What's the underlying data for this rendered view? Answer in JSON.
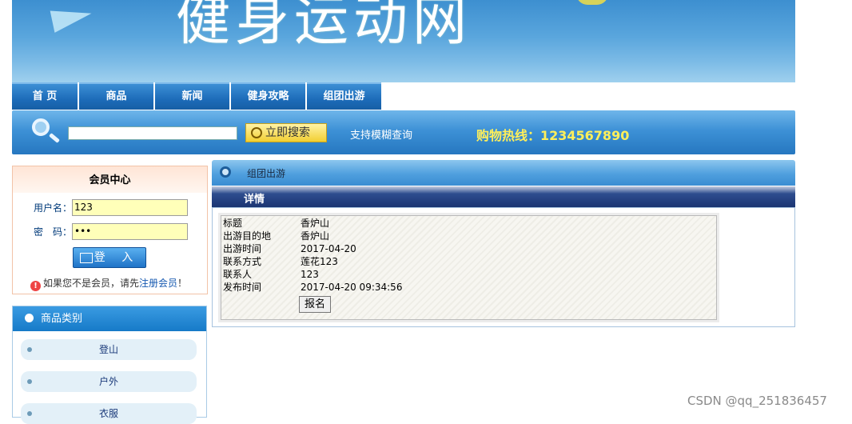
{
  "banner": {
    "title": "健身运动网"
  },
  "nav": {
    "tabs": [
      "首 页",
      "商品",
      "新闻",
      "健身攻略",
      "组团出游"
    ]
  },
  "search": {
    "value": "",
    "button_label": "立即搜索",
    "hint": "支持模糊查询",
    "hotline": "购物热线：1234567890"
  },
  "member": {
    "title": "会员中心",
    "username_label": "用户名：",
    "username_value": "123",
    "password_label": "密　码：",
    "password_value": "•••",
    "login_label": "登 入",
    "note_prefix": "如果您不是会员，请先",
    "note_link": "注册会员",
    "note_suffix": "！"
  },
  "category": {
    "title": "商品类别",
    "items": [
      "登山",
      "户外",
      "衣服"
    ]
  },
  "content": {
    "breadcrumb": "组团出游",
    "section_title": "详情",
    "rows": [
      {
        "key": "标题",
        "value": "香炉山"
      },
      {
        "key": "出游目的地",
        "value": "香炉山"
      },
      {
        "key": "出游时间",
        "value": "2017-04-20"
      },
      {
        "key": "联系方式",
        "value": "莲花123"
      },
      {
        "key": "联系人",
        "value": "123"
      },
      {
        "key": "发布时间",
        "value": "2017-04-20 09:34:56"
      }
    ],
    "signup_label": "报名"
  },
  "watermark": "CSDN @qq_251836457"
}
